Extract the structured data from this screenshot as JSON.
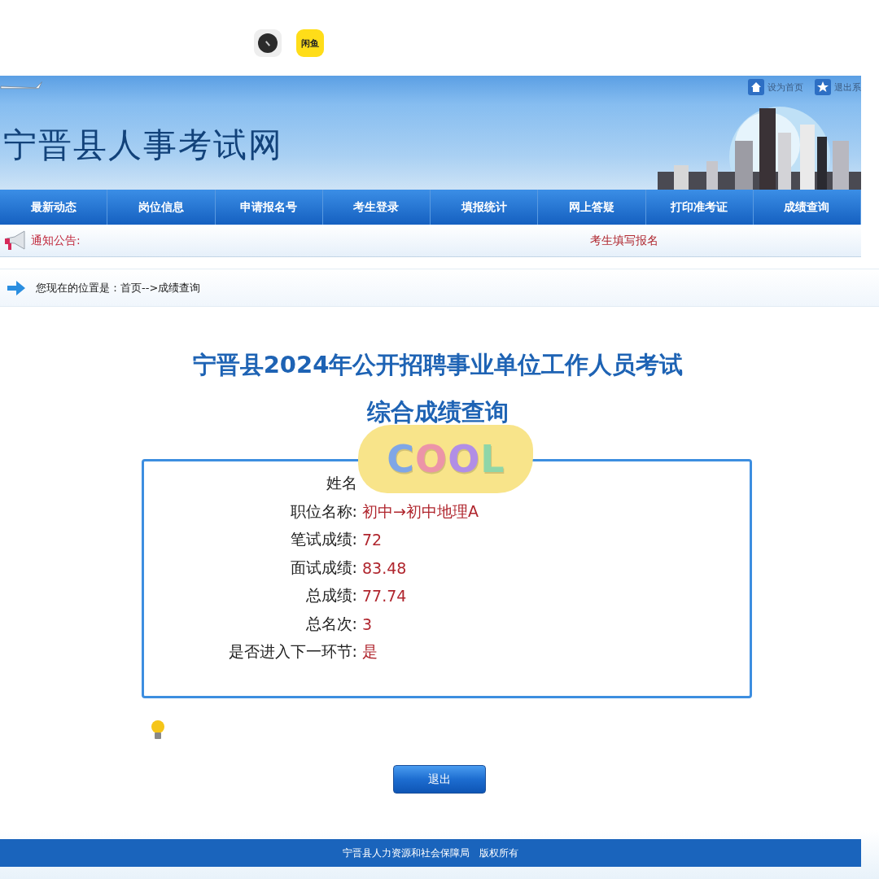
{
  "top_bar": {
    "app_icons": [
      {
        "kind": "dial"
      },
      {
        "kind": "app",
        "label": "闲鱼"
      }
    ]
  },
  "header": {
    "site_title": "宁晋县人事考试网",
    "links": [
      {
        "kind": "home",
        "label": "设为首页"
      },
      {
        "kind": "star",
        "label": "退出系"
      }
    ]
  },
  "nav": [
    "最新动态",
    "岗位信息",
    "申请报名号",
    "考生登录",
    "填报统计",
    "网上答疑",
    "打印准考证",
    "成绩查询"
  ],
  "notice": {
    "label": "通知公告:",
    "marquee": "考生填写报名"
  },
  "breadcrumb": "您现在的位置是：首页-->成绩查询",
  "main": {
    "title_lines": [
      "宁晋县2024年公开招聘事业单位工作人员考试",
      "综合成绩查询"
    ],
    "fields": [
      {
        "label": "姓名"
      },
      {
        "label": "职位名称:",
        "value": "初中→初中地理A"
      },
      {
        "label": "笔试成绩:",
        "value": "72"
      },
      {
        "label": "面试成绩:",
        "value": "83.48"
      },
      {
        "label": "总成绩:",
        "value": "77.74"
      },
      {
        "label": "总名次:",
        "value": "3"
      },
      {
        "label": "是否进入下一环节:",
        "value": "是"
      }
    ],
    "exit_button": "退出"
  },
  "sticker": {
    "text": "COOL"
  },
  "footer": "宁晋县人力资源和社会保障局　版权所有"
}
